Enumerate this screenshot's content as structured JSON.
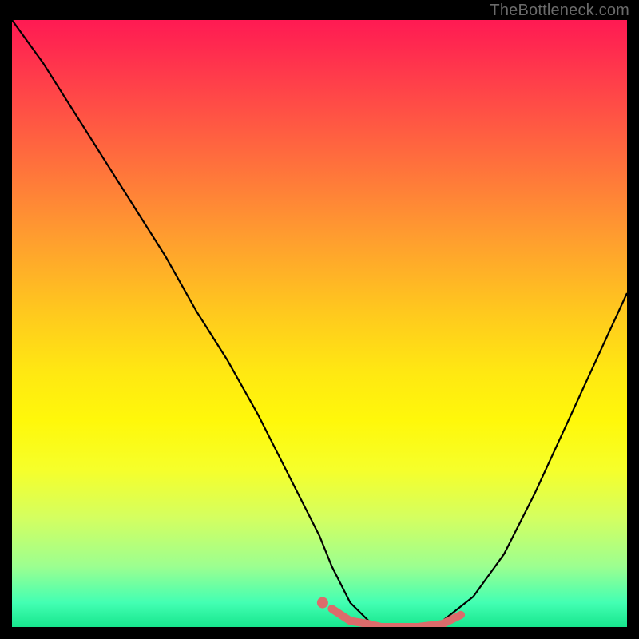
{
  "watermark": "TheBottleneck.com",
  "colors": {
    "frame": "#000000",
    "curve_main": "#000000",
    "curve_accent": "#dc6b6b",
    "gradient_top": "#ff1a53",
    "gradient_bottom": "#17e68d"
  },
  "chart_data": {
    "type": "line",
    "title": "",
    "xlabel": "",
    "ylabel": "",
    "xlim": [
      0,
      100
    ],
    "ylim": [
      0,
      100
    ],
    "series": [
      {
        "name": "bottleneck-curve",
        "x": [
          0,
          5,
          10,
          15,
          20,
          25,
          30,
          35,
          40,
          45,
          50,
          52,
          55,
          58,
          60,
          63,
          66,
          70,
          75,
          80,
          85,
          90,
          95,
          100
        ],
        "values": [
          100,
          93,
          85,
          77,
          69,
          61,
          52,
          44,
          35,
          25,
          15,
          10,
          4,
          1,
          0,
          0,
          0,
          1,
          5,
          12,
          22,
          33,
          44,
          55
        ]
      },
      {
        "name": "accent-segment",
        "x": [
          52,
          55,
          58,
          60,
          63,
          66,
          70,
          73
        ],
        "values": [
          3,
          1,
          0.5,
          0,
          0,
          0,
          0.5,
          2
        ]
      }
    ],
    "annotations": []
  }
}
